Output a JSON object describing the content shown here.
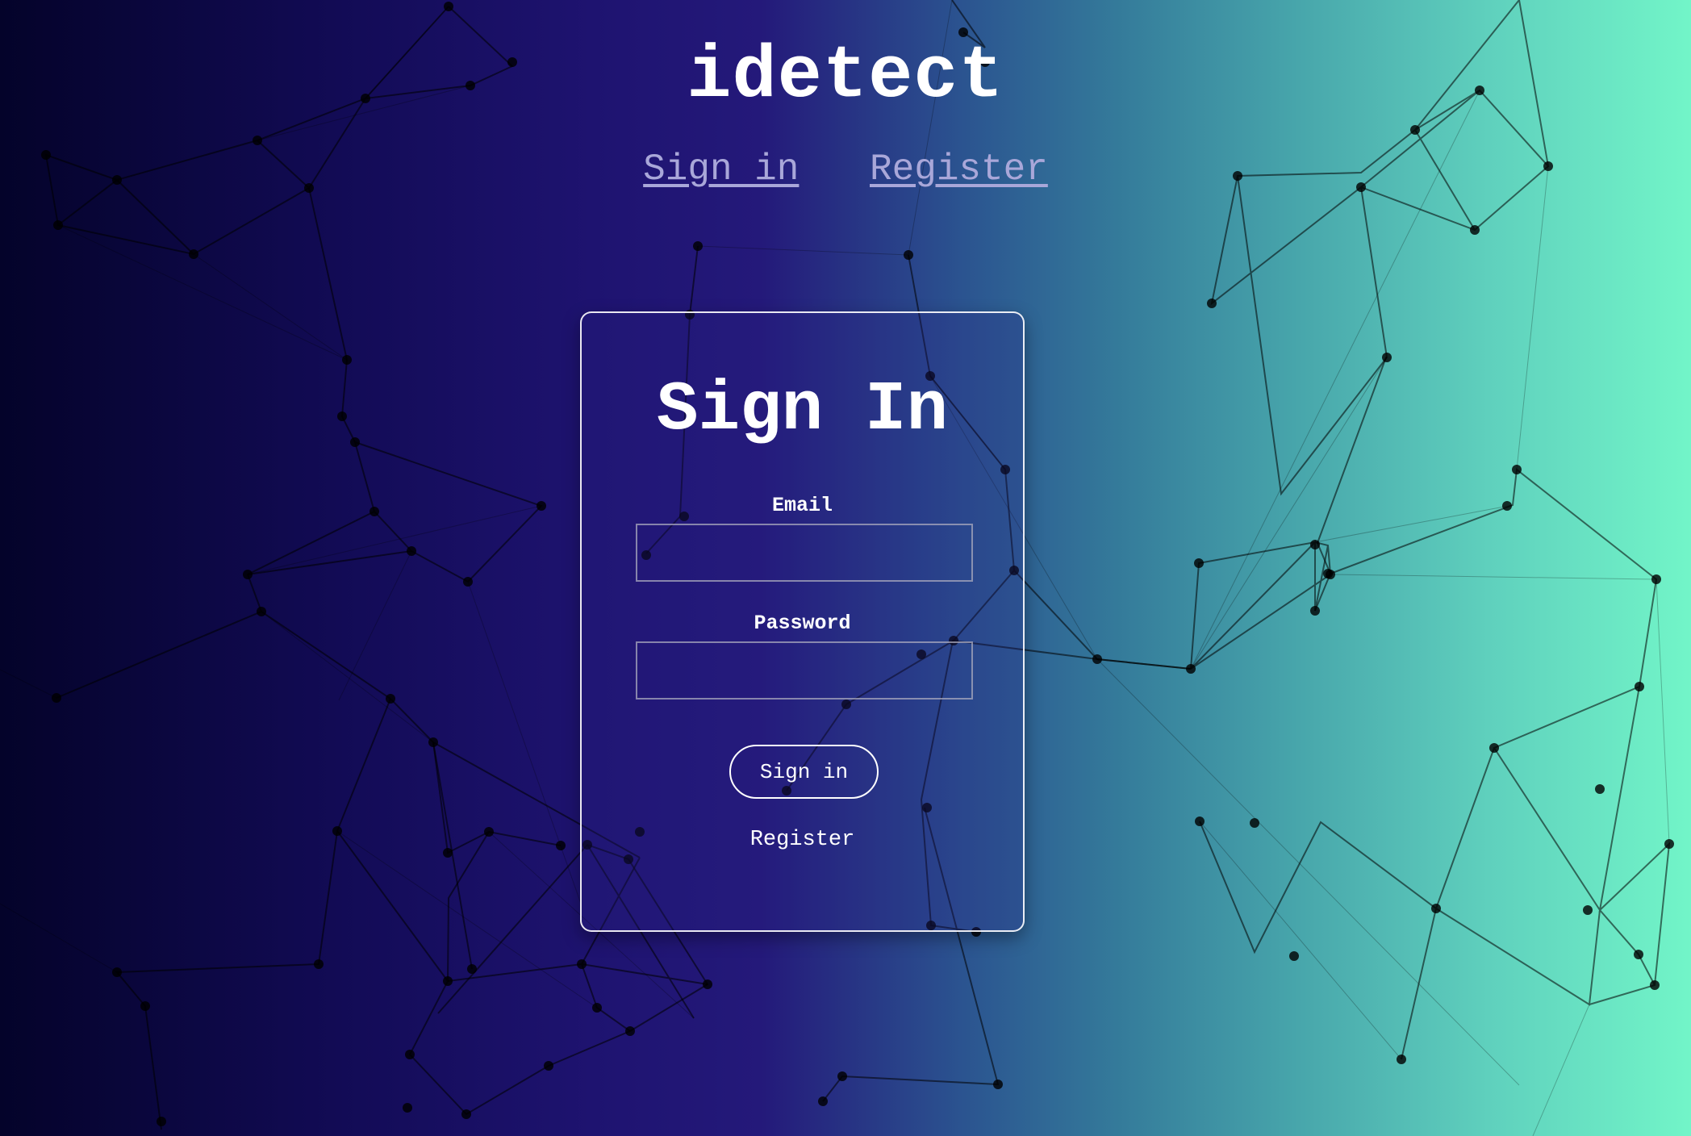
{
  "brand": {
    "name": "idetect"
  },
  "nav": {
    "sign_in": "Sign in",
    "register": "Register"
  },
  "signin_card": {
    "title": "Sign In",
    "email_label": "Email",
    "email_value": "",
    "password_label": "Password",
    "password_value": "",
    "submit_label": "Sign in",
    "register_label": "Register"
  },
  "colors": {
    "gradient_left": "#04032a",
    "gradient_mid": "#24197a",
    "gradient_right": "#72f5c8",
    "network_lines": "#000000"
  },
  "icons": {
    "background": "network-mesh-pattern"
  }
}
